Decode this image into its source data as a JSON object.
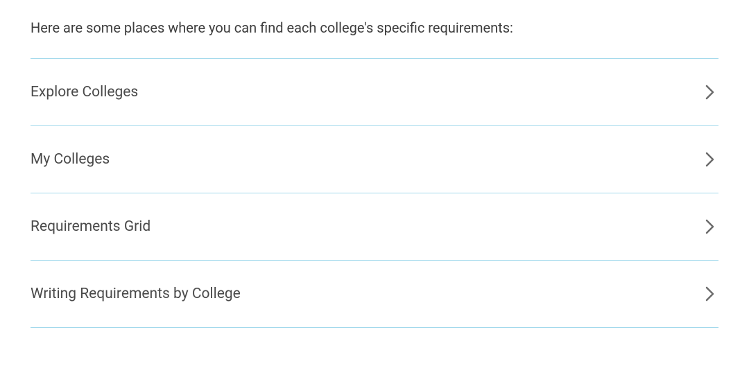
{
  "intro": "Here are some places where you can find each college's specific requirements:",
  "items": [
    {
      "label": "Explore Colleges"
    },
    {
      "label": "My Colleges"
    },
    {
      "label": "Requirements Grid"
    },
    {
      "label": "Writing Requirements by College"
    }
  ]
}
